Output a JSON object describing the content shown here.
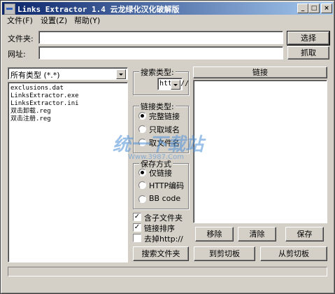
{
  "window": {
    "title": "Links Extractor 1.4  云龙绿化汉化破解版"
  },
  "titlebar_buttons": {
    "minimize": "_",
    "maximize": "□",
    "close": "×"
  },
  "menu": [
    "文件(F)",
    "设置(Z)",
    "帮助(Y)"
  ],
  "folder": {
    "label": "文件夹:",
    "value": "",
    "browse_button": "选择"
  },
  "url": {
    "label": "网址:",
    "value": "",
    "fetch_button": "抓取"
  },
  "file_type_filter": {
    "selected": "所有类型 (*.*)"
  },
  "files": [
    "exclusions.dat",
    "LinksExtractor.exe",
    "LinksExtractor.ini",
    "双击卸载.reg",
    "双击注册.reg"
  ],
  "search_type": {
    "title": "搜索类型:",
    "selected": "http://"
  },
  "link_type": {
    "title": "链接类型:",
    "options": [
      "完整链接",
      "只取域名",
      "取文件名"
    ],
    "selected_index": 0
  },
  "save_method": {
    "title": "保存方式",
    "options": [
      "仅链接",
      "HTTP编码",
      "BB code"
    ],
    "selected_index": 0
  },
  "checkboxes": [
    {
      "label": "含子文件夹",
      "checked": true
    },
    {
      "label": "链接排序",
      "checked": true
    },
    {
      "label": "去掉http://",
      "checked": false
    }
  ],
  "links_panel": {
    "header": "链接"
  },
  "buttons": {
    "remove": "移除",
    "clear": "清除",
    "save": "保存",
    "search_folder": "搜索文件夹",
    "to_clipboard": "到剪切板",
    "from_clipboard": "从剪切板"
  },
  "watermark": {
    "brand": "统一下载站",
    "site": "Www.3987.Com"
  }
}
